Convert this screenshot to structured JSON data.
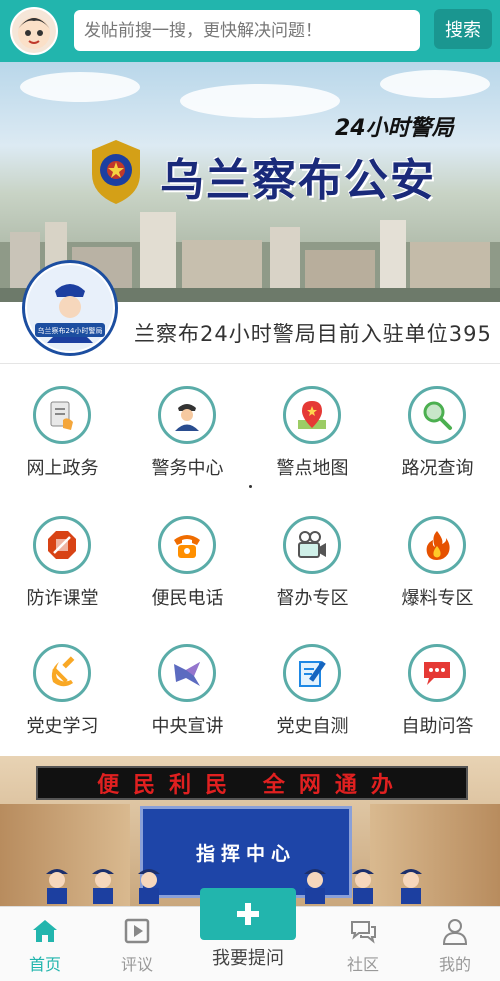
{
  "header": {
    "search_placeholder": "发帖前搜一搜，更快解决问题！",
    "search_button": "搜索"
  },
  "banner": {
    "title": "乌兰察布公安",
    "subtitle": "24小时警局"
  },
  "ticker": {
    "logo_text": "乌兰察布24小时警局",
    "text": "兰察布24小时警局目前入驻单位395"
  },
  "grid": [
    {
      "label": "网上政务",
      "icon": "document-hand-icon"
    },
    {
      "label": "警务中心",
      "icon": "police-officer-icon"
    },
    {
      "label": "警点地图",
      "icon": "map-pin-icon"
    },
    {
      "label": "路况查询",
      "icon": "magnifier-icon"
    },
    {
      "label": "防诈课堂",
      "icon": "stop-sign-icon"
    },
    {
      "label": "便民电话",
      "icon": "telephone-icon"
    },
    {
      "label": "督办专区",
      "icon": "video-camera-icon"
    },
    {
      "label": "爆料专区",
      "icon": "flame-icon"
    },
    {
      "label": "党史学习",
      "icon": "hammer-sickle-icon"
    },
    {
      "label": "中央宣讲",
      "icon": "megaphone-icon"
    },
    {
      "label": "党史自测",
      "icon": "pencil-note-icon"
    },
    {
      "label": "自助问答",
      "icon": "chat-bubble-icon"
    }
  ],
  "poster": {
    "banner_text": "便民利民 全网通办",
    "screen_text": "指挥中心"
  },
  "tabbar": {
    "home": "首页",
    "review": "评议",
    "ask": "我要提问",
    "community": "社区",
    "mine": "我的"
  },
  "colors": {
    "primary": "#22b5ad",
    "primary_dark": "#1a9690",
    "icon_ring": "#5aaca8"
  }
}
